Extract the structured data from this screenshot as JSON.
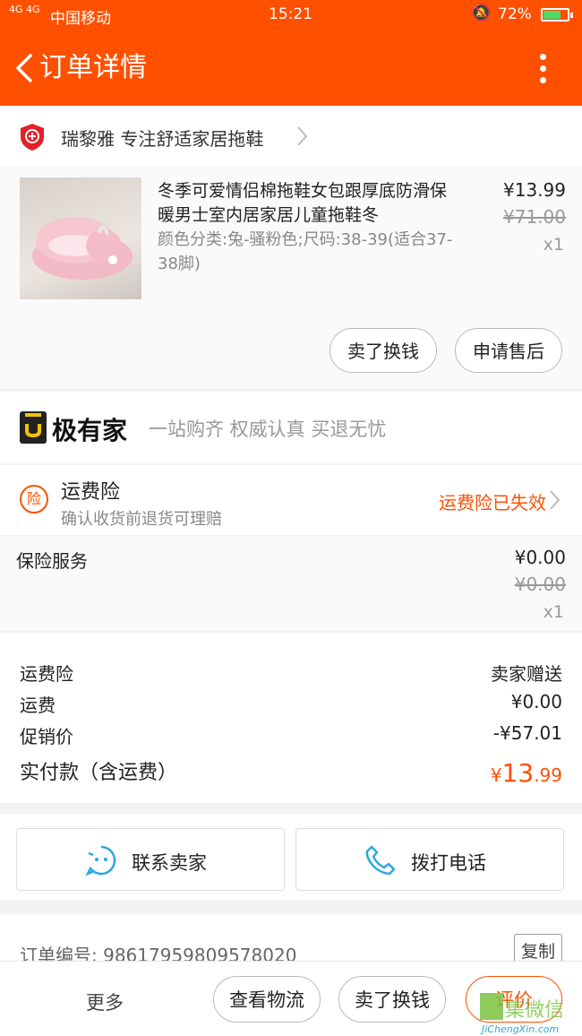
{
  "status_bar": {
    "network": "4G 4G",
    "carrier": "中国移动",
    "time": "15:21",
    "battery": "72%",
    "battery_level": 0.72
  },
  "nav": {
    "title": "订单详情"
  },
  "shop": {
    "name": "瑞黎雅 专注舒适家居拖鞋"
  },
  "product": {
    "title": "冬季可爱情侣棉拖鞋女包跟厚底防滑保暖男士室内居家居儿童拖鞋冬",
    "spec": "颜色分类:兔-骚粉色;尺码:38-39(适合37-38脚)",
    "price": "¥13.99",
    "original_price": "¥71.00",
    "quantity": "x1",
    "buttons": [
      "卖了换钱",
      "申请售后"
    ]
  },
  "jiyoujia": {
    "brand": "极有家",
    "slogan": "一站购齐 权威认真 买退无忧"
  },
  "insurance": {
    "badge": "险",
    "title": "运费险",
    "subtitle": "确认收货前退货可理赔",
    "status": "运费险已失效"
  },
  "service": {
    "label": "保险服务",
    "price": "¥0.00",
    "original_price": "¥0.00",
    "quantity": "x1"
  },
  "summary": {
    "rows": [
      {
        "label": "运费险",
        "value": "卖家赠送"
      },
      {
        "label": "运费",
        "value": "¥0.00"
      },
      {
        "label": "促销价",
        "value": "-¥57.01"
      }
    ],
    "total_label": "实付款（含运费）",
    "total_currency": "¥",
    "total_int": "13",
    "total_dec": ".99"
  },
  "contact": {
    "seller": "联系卖家",
    "phone": "拨打电话"
  },
  "order": {
    "number": "订单编号: 98617959809578020",
    "copy": "复制"
  },
  "bottom_bar": {
    "more": "更多",
    "buttons": [
      "查看物流",
      "卖了换钱",
      "评价"
    ]
  },
  "watermark": {
    "text": "集微信",
    "url": "JiChengXin.com"
  },
  "colors": {
    "accent": "#ff5000"
  }
}
